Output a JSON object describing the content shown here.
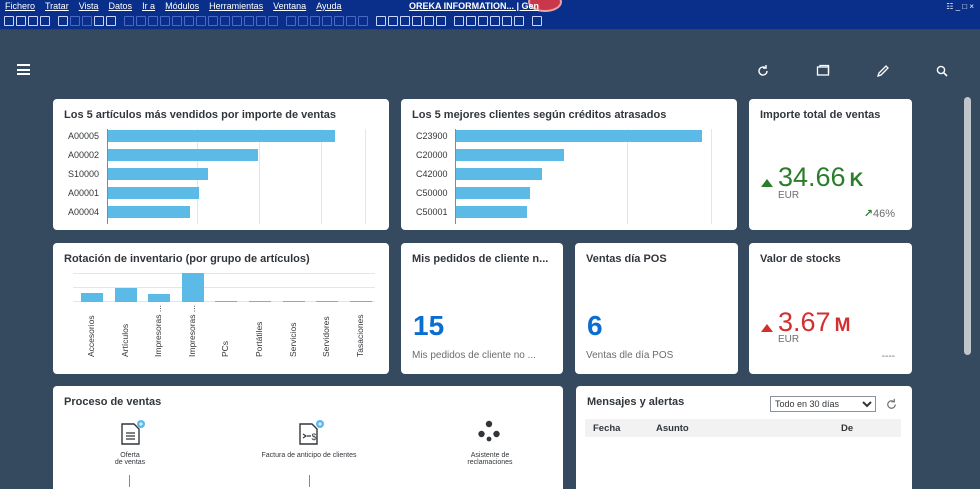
{
  "menubar": {
    "items": [
      "Fichero",
      "Tratar",
      "Vista",
      "Datos",
      "Ir a",
      "Módulos",
      "Herramientas",
      "Ventana",
      "Ayuda"
    ],
    "window_title": "OREKA INFORMATION... | Gen",
    "window_controls": "☷ _ □ ×"
  },
  "header": {
    "menu_icon": "hamburger-icon",
    "actions": [
      "refresh-icon",
      "window-icon",
      "edit-icon",
      "search-icon"
    ]
  },
  "cards": {
    "top_articles": {
      "title": "Los 5 artículos más vendidos por importe de ventas"
    },
    "top_clients": {
      "title": "Los 5 mejores clientes según créditos atrasados"
    },
    "total_sales": {
      "title": "Importe total de ventas",
      "value": "34.66",
      "unit_suffix": "K",
      "currency": "EUR",
      "trend": "46%",
      "color": "#2b7d2b"
    },
    "inventory_rotation": {
      "title": "Rotación de inventario (por grupo de artículos)"
    },
    "my_orders": {
      "title": "Mis pedidos de cliente n...",
      "value": "15",
      "subtitle": "Mis pedidos de cliente no ..."
    },
    "pos_sales": {
      "title": "Ventas día POS",
      "value": "6",
      "subtitle": "Ventas dle día POS"
    },
    "stock_value": {
      "title": "Valor de stocks",
      "value": "3.67",
      "unit_suffix": "M",
      "currency": "EUR",
      "trend": "----",
      "color": "#d32f2f"
    },
    "sales_process": {
      "title": "Proceso de ventas",
      "steps": [
        {
          "label_line1": "Oferta",
          "label_line2": "de ventas",
          "icon": "document-icon"
        },
        {
          "label_line1": "Factura de anticipo de clientes",
          "label_line2": "",
          "icon": "invoice-icon"
        },
        {
          "label_line1": "Asistente de",
          "label_line2": "reclamaciones",
          "icon": "network-icon"
        }
      ]
    },
    "messages": {
      "title": "Mensajes y alertas",
      "filter_value": "Todo en 30 días",
      "columns": [
        "Fecha",
        "Asunto",
        "De"
      ]
    }
  },
  "chart_data": [
    {
      "type": "bar",
      "orientation": "horizontal",
      "categories": [
        "A00005",
        "A00002",
        "S10000",
        "A00001",
        "A00004"
      ],
      "values": [
        100,
        66,
        44,
        40,
        36
      ],
      "title": "Los 5 artículos más vendidos por importe de ventas",
      "grid": true
    },
    {
      "type": "bar",
      "orientation": "horizontal",
      "categories": [
        "C23900",
        "C20000",
        "C42000",
        "C50000",
        "C50001"
      ],
      "values": [
        100,
        44,
        35,
        30,
        29
      ],
      "title": "Los 5 mejores clientes según créditos atrasados",
      "grid": true
    },
    {
      "type": "bar",
      "orientation": "vertical",
      "categories": [
        "Accesorios",
        "Artículos",
        "Impresoras ...",
        "Impresoras ...",
        "PCs",
        "Portátiles",
        "Servicios",
        "Servidores",
        "Tasaciones"
      ],
      "values": [
        32,
        48,
        28,
        100,
        2,
        1,
        4,
        2,
        0
      ],
      "title": "Rotación de inventario (por grupo de artículos)",
      "grid": true
    }
  ]
}
